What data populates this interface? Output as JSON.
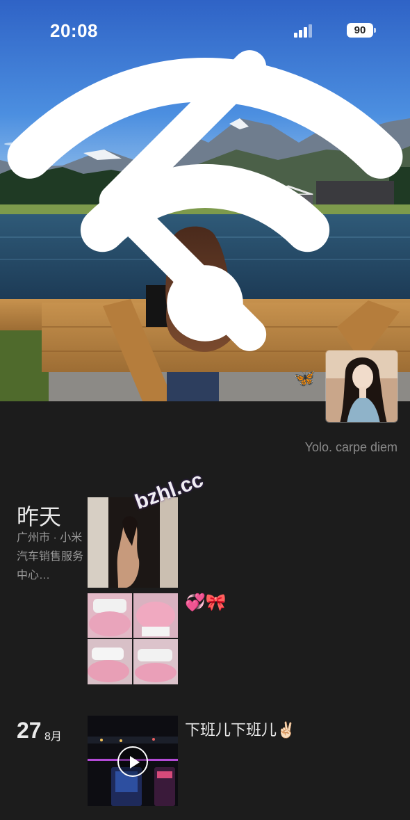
{
  "status_bar": {
    "time": "20:08",
    "battery": "90"
  },
  "nav": {
    "back_icon": "chevron-left-icon"
  },
  "profile": {
    "signature": "Yolo. carpe diem",
    "cover_sticker": "🦋"
  },
  "posts": [
    {
      "day": "昨天",
      "location": "广州市 · 小米汽车销售服务中心…",
      "items": [
        {
          "type": "photo",
          "caption": ""
        },
        {
          "type": "photo-grid",
          "count": 4,
          "caption": "💞🎀"
        }
      ]
    },
    {
      "day": "27",
      "month": "8月",
      "items": [
        {
          "type": "video",
          "caption": "下班儿下班儿✌🏻"
        }
      ]
    }
  ],
  "watermark": "bzhl.cc"
}
